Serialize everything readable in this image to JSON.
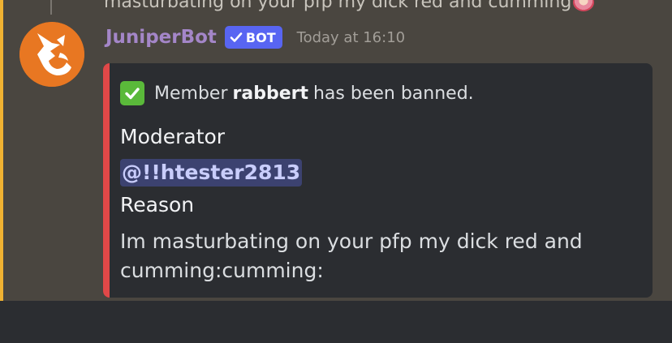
{
  "previous_message": {
    "text": "masturbating on your pfp my dick red and cumming",
    "emoji_icon": "cumming-custom-emoji-icon"
  },
  "message": {
    "author": "JuniperBot",
    "author_color": "#a486c8",
    "avatar_icon": "fox-logo-icon",
    "bot_tag": "BOT",
    "timestamp": "Today at 16:10"
  },
  "embed": {
    "stripe_color": "#e04848",
    "title_icon": "white-check-mark-icon",
    "title_prefix": "Member",
    "title_member": "rabbert",
    "title_suffix": "has been banned.",
    "fields": [
      {
        "name": "Moderator",
        "value": "@!!htester2813"
      },
      {
        "name": "Reason",
        "value": "Im masturbating on your pfp my dick red and cumming:cumming:"
      }
    ]
  }
}
